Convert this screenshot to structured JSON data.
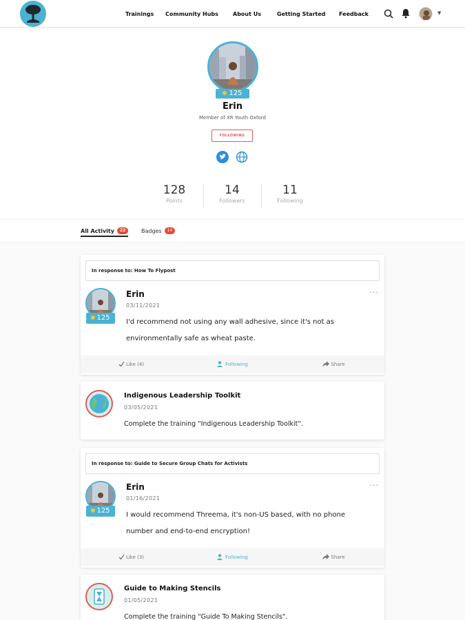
{
  "nav": {
    "links": [
      "Trainings",
      "Community Hubs",
      "About Us",
      "Getting Started",
      "Feedback"
    ],
    "icons": [
      "search-icon",
      "bell-icon",
      "user-avatar",
      "caret-down-icon"
    ]
  },
  "profile": {
    "name": "Erin",
    "score": "125",
    "member_of": "Member of XR Youth Oxford",
    "follow_label": "FOLLOWING",
    "social_icons": [
      "twitter-icon",
      "globe-icon"
    ],
    "stats": [
      {
        "value": "128",
        "label": "Points"
      },
      {
        "value": "14",
        "label": "Followers"
      },
      {
        "value": "11",
        "label": "Following"
      }
    ]
  },
  "tabs": [
    {
      "label": "All Activity",
      "count": "22",
      "active": true
    },
    {
      "label": "Badges",
      "count": "14",
      "active": false
    }
  ],
  "feed": [
    {
      "type": "comment",
      "in_response_to": "In response to: How To Flypost",
      "author": "Erin",
      "score": "125",
      "date": "03/11/2021",
      "text_lines": [
        "I'd recommend not using any wall adhesive, since it's not as",
        "environmentally safe as wheat paste."
      ],
      "actions": {
        "like": "Like (4)",
        "follow": "Following",
        "share": "Share"
      }
    },
    {
      "type": "training",
      "title": "Indigenous Leadership Toolkit",
      "date": "03/05/2021",
      "text": "Complete the training \"Indigenous Leadership Toolkit\"."
    },
    {
      "type": "comment",
      "in_response_to": "In response to: Guide to Secure Group Chats for Activists",
      "author": "Erin",
      "score": "125",
      "date": "01/16/2021",
      "text_lines": [
        "I would recommend Threema, it's non-US based, with no phone",
        "number and end-to-end encryption!"
      ],
      "actions": {
        "like": "Like (3)",
        "follow": "Following",
        "share": "Share"
      }
    },
    {
      "type": "training",
      "title": "Guide to Making Stencils",
      "date": "01/05/2021",
      "text": "Complete the training \"Guide To Making Stencils\"."
    }
  ],
  "colors": {
    "accent": "#4bb2d4",
    "badge": "#e04d3a",
    "follow_red": "#e05a5a",
    "star": "#f4c430"
  }
}
